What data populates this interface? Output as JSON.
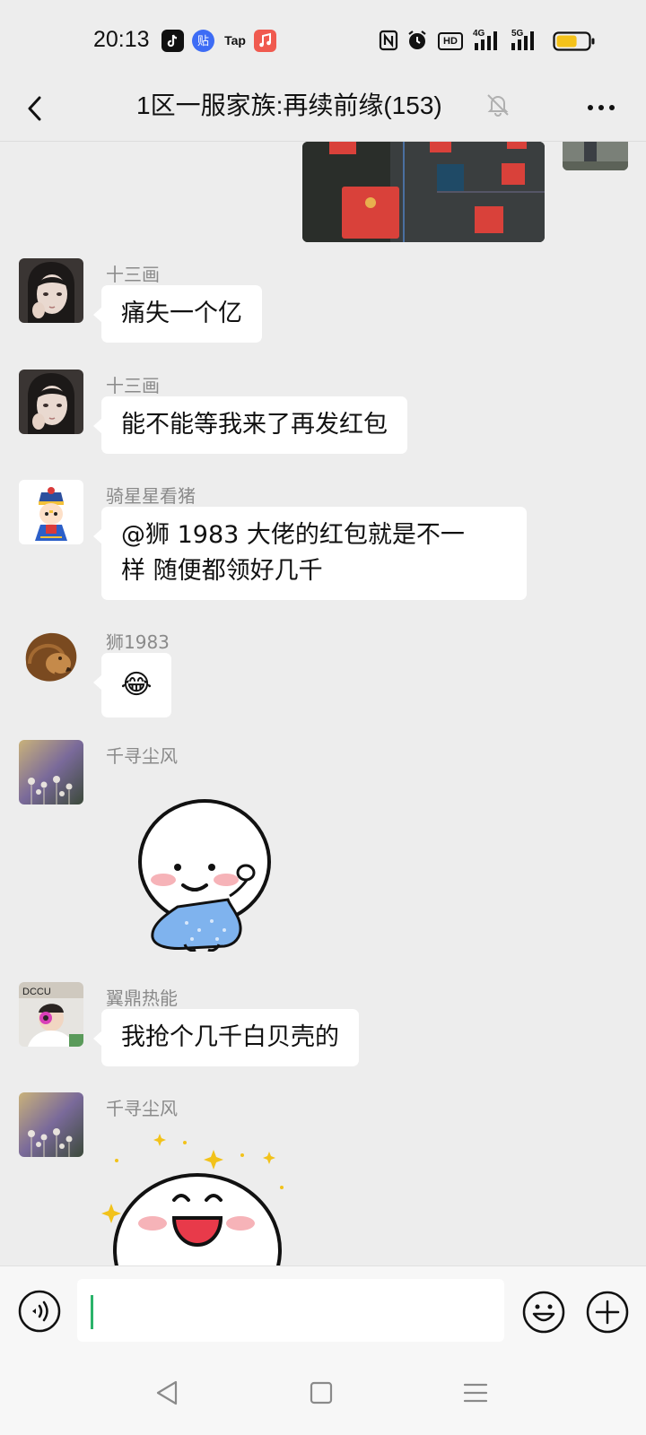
{
  "status_bar": {
    "time": "20:13",
    "app_icons": [
      {
        "name": "tiktok-icon",
        "label": "",
        "color": "#111111"
      },
      {
        "name": "tieba-icon",
        "label": "贴",
        "color": "#3d6cf5"
      },
      {
        "name": "taptap-icon",
        "label": "Tap",
        "color": "#ffffff"
      },
      {
        "name": "music-icon",
        "label": "",
        "color": "#f05a4f"
      }
    ],
    "indicators": [
      "nfc-icon",
      "alarm-icon",
      "hd-icon",
      "signal-4g-icon",
      "signal-5g-icon",
      "battery-icon"
    ],
    "hd_label": "HD",
    "net1_label": "4G",
    "net2_label": "5G",
    "battery_level": 0.65,
    "battery_color": "#f4c21a"
  },
  "header": {
    "title": "1区一服家族:再续前缘(153)",
    "back_icon": "chevron-left-icon",
    "mute_icon": "bell-off-icon",
    "more_icon": "more-horizontal-icon"
  },
  "messages": [
    {
      "sender": "十三画",
      "type": "text",
      "text": "痛失一个亿",
      "avatar": "avatar-anime-girl"
    },
    {
      "sender": "十三画",
      "type": "text",
      "text": "能不能等我来了再发红包",
      "avatar": "avatar-anime-girl"
    },
    {
      "sender": "骑星星看猪",
      "type": "text",
      "line1": "@狮 1983  大佬的红包就是不一",
      "line2": "样 随便都领好几千",
      "avatar": "avatar-cartoon-boy"
    },
    {
      "sender": "狮1983",
      "type": "emoji",
      "emoji": "😂",
      "avatar": "avatar-lion"
    },
    {
      "sender": "千寻尘风",
      "type": "sticker",
      "sticker": "sticker-waving-blob",
      "avatar": "avatar-dandelions"
    },
    {
      "sender": "翼鼎热能",
      "type": "text",
      "text": "我抢个几千白贝壳的",
      "avatar": "avatar-child-photo"
    },
    {
      "sender": "千寻尘风",
      "type": "sticker",
      "sticker": "sticker-happy-blob",
      "avatar": "avatar-dandelions"
    }
  ],
  "input_bar": {
    "voice_icon": "voice-icon",
    "input_value": "",
    "emoji_icon": "emoji-icon",
    "plus_icon": "plus-circle-icon"
  },
  "system_nav": [
    "back-triangle-icon",
    "home-square-icon",
    "menu-lines-icon"
  ],
  "colors": {
    "background": "#ededed",
    "bubble": "#ffffff",
    "caret": "#2bb36a",
    "red_packet": "#d9413a"
  }
}
